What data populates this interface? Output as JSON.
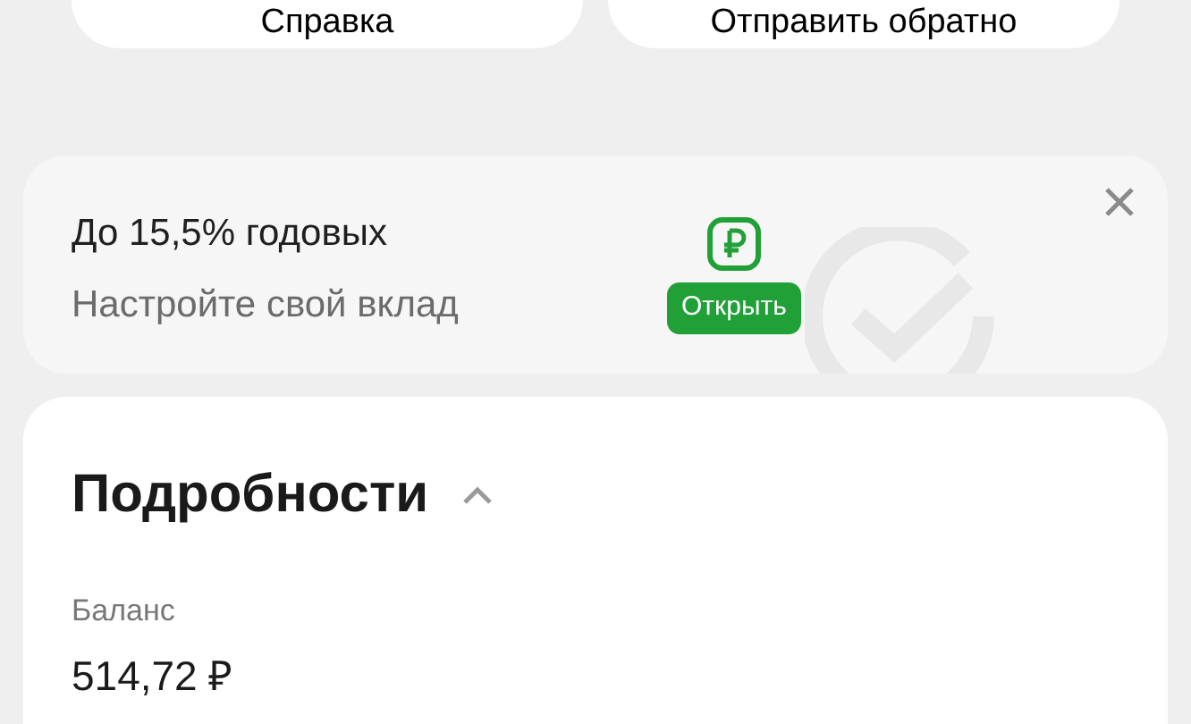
{
  "top_buttons": [
    {
      "label": "Справка"
    },
    {
      "label": "Отправить обратно"
    }
  ],
  "promo": {
    "title": "До 15,5% годовых",
    "subtitle": "Настройте свой вклад",
    "button": "Открыть"
  },
  "details": {
    "title": "Подробности",
    "expanded": true,
    "balance_label": "Баланс",
    "balance": "514,72 ₽"
  }
}
